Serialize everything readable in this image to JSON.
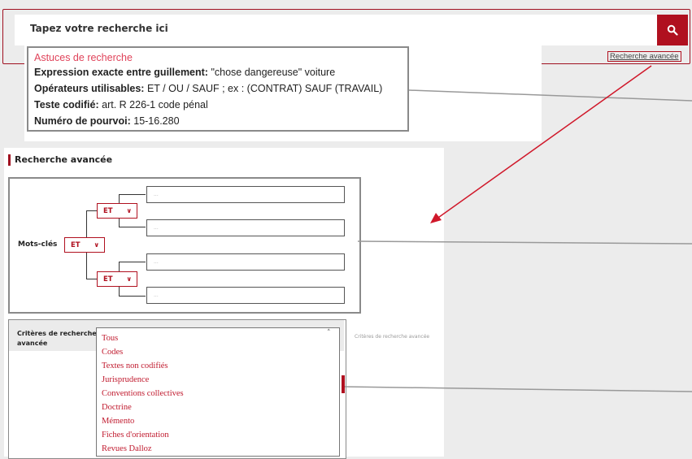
{
  "search": {
    "placeholder": "Tapez votre recherche ici",
    "advanced_link": "Recherche avancée"
  },
  "tips": {
    "title": "Astuces de recherche",
    "lines": [
      {
        "label": "Expression exacte entre guillement:",
        "value": " \"chose dangereuse\" voiture"
      },
      {
        "label": "Opérateurs utilisables:",
        "value": " ET / OU / SAUF ; ex : (CONTRAT) SAUF (TRAVAIL)"
      },
      {
        "label": "Teste codifié:",
        "value": " art. R 226-1 code pénal"
      },
      {
        "label": "Numéro de pourvoi:",
        "value": " 15-16.280"
      }
    ]
  },
  "advanced": {
    "title": "Recherche avancée",
    "keywords_label": "Mots-clés",
    "operators": [
      "ET",
      "ET",
      "ET"
    ],
    "input_placeholder": "..."
  },
  "criteria": {
    "label": "Critères de recherche avancée",
    "side_label": "Critères de recherche avancée",
    "options": [
      "Tous",
      "Codes",
      "Textes non codifiés",
      "Jurisprudence",
      "Conventions collectives",
      "Doctrine",
      "Mémento",
      "Fiches d'orientation",
      "Revues Dalloz"
    ]
  },
  "colors": {
    "accent": "#b0101f",
    "tip_title": "#e0435a",
    "arrow": "#d0182a"
  },
  "icons": {
    "search": "search-icon",
    "chevron": "chevron-down-icon",
    "caret_up": "chevron-up-icon"
  }
}
